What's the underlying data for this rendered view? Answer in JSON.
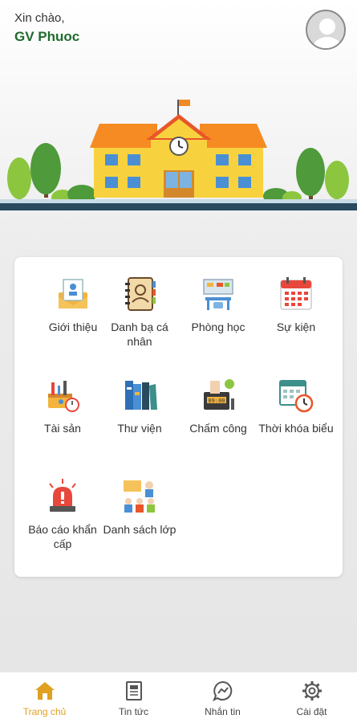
{
  "header": {
    "greeting": "Xin chào,",
    "user_name": "GV Phuoc"
  },
  "menu": {
    "items": [
      {
        "label": "Giới thiệu",
        "icon": "intro-icon"
      },
      {
        "label": "Danh bạ cá nhân",
        "icon": "contacts-icon"
      },
      {
        "label": "Phòng học",
        "icon": "classroom-icon"
      },
      {
        "label": "Sự kiện",
        "icon": "calendar-icon"
      },
      {
        "label": "Tài sản",
        "icon": "assets-icon"
      },
      {
        "label": "Thư viện",
        "icon": "library-icon"
      },
      {
        "label": "Chấm công",
        "icon": "timekeeping-icon"
      },
      {
        "label": "Thời khóa biểu",
        "icon": "timetable-icon"
      },
      {
        "label": "Báo cáo khẩn cấp",
        "icon": "emergency-icon"
      },
      {
        "label": "Danh sách lớp",
        "icon": "class-list-icon"
      }
    ]
  },
  "bottom_nav": {
    "items": [
      {
        "label": "Trang chủ",
        "icon": "home-icon",
        "active": true
      },
      {
        "label": "Tin tức",
        "icon": "news-icon",
        "active": false
      },
      {
        "label": "Nhắn tin",
        "icon": "chat-icon",
        "active": false
      },
      {
        "label": "Cài đặt",
        "icon": "gear-icon",
        "active": false
      }
    ]
  },
  "colors": {
    "accent": "#e0a020",
    "name_green": "#1f6b2c",
    "nav_inactive": "#444444"
  }
}
